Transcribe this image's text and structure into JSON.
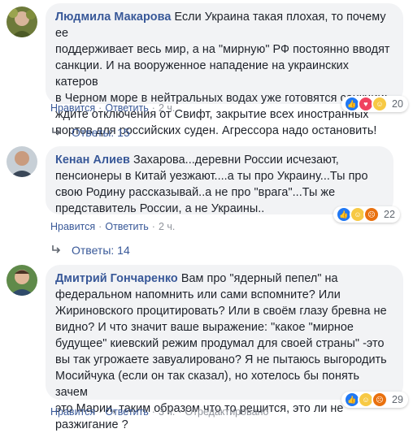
{
  "comments": [
    {
      "author": "Людмила Макарова",
      "text_lines": [
        "Если Украина такая плохая, то почему ее",
        "поддерживает весь мир, а на \"мирную\" РФ постоянно вводят",
        "санкции. И на вооруженное нападение на украинских катеров",
        "в Черном море в нейтральных водах уже готовятся санкции:",
        "ждите отключения от Свифт, закрытие всех иностранных",
        "портов для российских суден. Агрессора надо остановить!"
      ],
      "reaction_count": "20",
      "like_label": "Нравится",
      "reply_label": "Ответить",
      "time": "2 ч.",
      "replies_label": "Ответы: 15"
    },
    {
      "author": "Кенан Алиев",
      "text_lines": [
        "Захарова...деревни России исчезают,",
        "пенсионеры в Китай уезжают....а ты про Украину...Ты про",
        "свою Родину рассказывай..а не про \"врага\"...Ты же",
        "представитель России, а не Украины.."
      ],
      "reaction_count": "22",
      "like_label": "Нравится",
      "reply_label": "Ответить",
      "time": "2 ч.",
      "replies_label": "Ответы: 14"
    },
    {
      "author": "Дмитрий Гончаренко",
      "text_lines": [
        "Вам про \"ядерный пепел\" на",
        "федеральном напомнить или сами вспомните? Или",
        "Жириновского процитировать? Или в своём глазу бревна не",
        "видно? И что значит ваше выражение: \"какое \"мирное",
        "будущее\" киевский режим продумал для своей страны\" -это",
        "вы так угрожаете завуалировано? Я не пытаюсь выгородить",
        "Мосийчука (если он так сказал), но хотелось бы понять зачем",
        "это Марии, таким образом что то решится, это ли не",
        "разжигание ?"
      ],
      "reaction_count": "29",
      "like_label": "Нравится",
      "reply_label": "Ответить",
      "time": "3 ч.",
      "edited_label": "Отредактировано"
    }
  ],
  "colors": {
    "link": "#385898",
    "bubble": "#f2f3f5",
    "meta": "#90949c"
  },
  "icons": [
    "like-icon",
    "haha-icon",
    "angry-icon",
    "reply-arrow-icon"
  ]
}
